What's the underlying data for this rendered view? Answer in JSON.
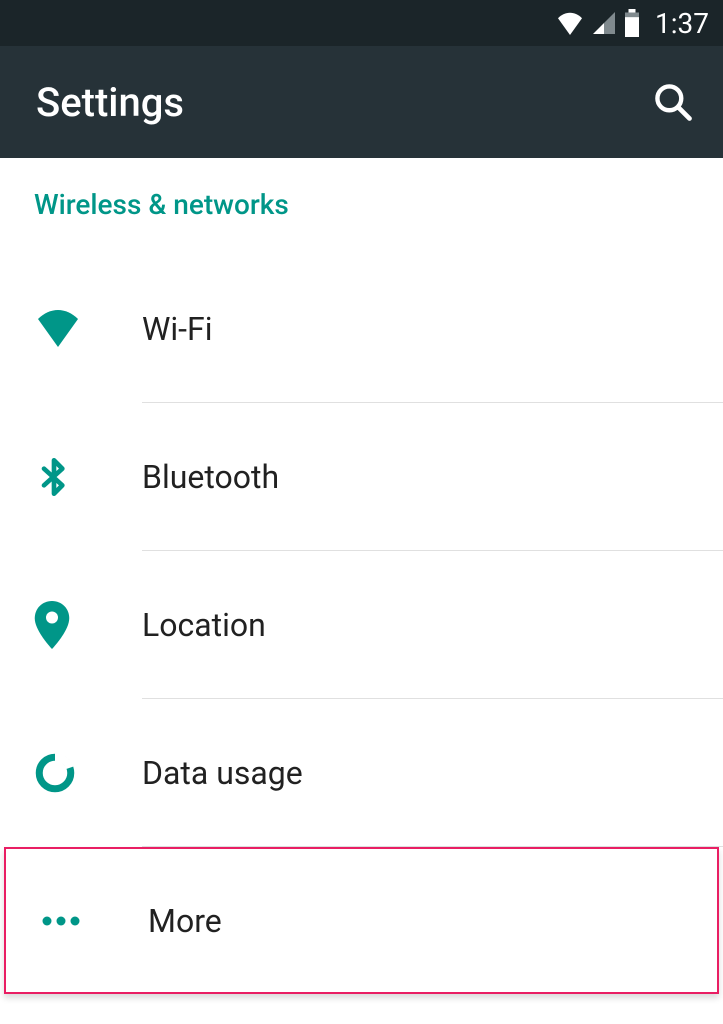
{
  "status": {
    "time": "1:37"
  },
  "header": {
    "title": "Settings"
  },
  "section": {
    "title": "Wireless & networks"
  },
  "items": [
    {
      "label": "Wi-Fi"
    },
    {
      "label": "Bluetooth"
    },
    {
      "label": "Location"
    },
    {
      "label": "Data usage"
    },
    {
      "label": "More"
    }
  ],
  "colors": {
    "accent": "#009688",
    "appbar": "#263238",
    "statusbar": "#1b2529"
  }
}
